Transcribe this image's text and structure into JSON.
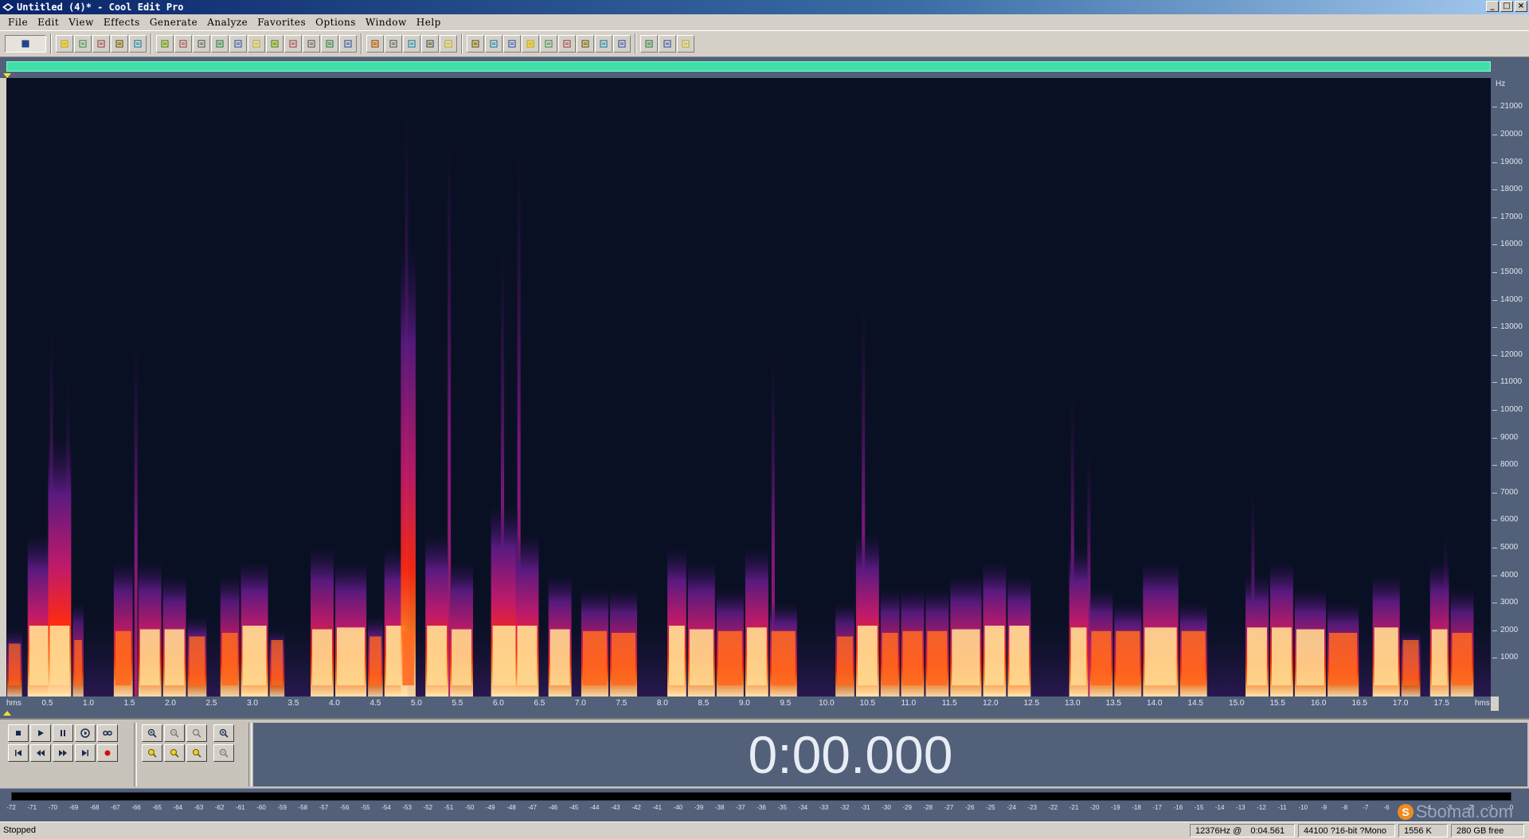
{
  "window": {
    "title": "Untitled (4)* - Cool Edit Pro",
    "controls": [
      "_",
      "□",
      "×"
    ]
  },
  "menu": [
    "File",
    "Edit",
    "View",
    "Effects",
    "Generate",
    "Analyze",
    "Favorites",
    "Options",
    "Window",
    "Help"
  ],
  "toolbar": {
    "groups": [
      [
        "waveform-view-toggle-icon"
      ],
      [
        "new-file-icon",
        "open-file-icon",
        "save-icon",
        "save-as-icon",
        "close-icon"
      ],
      [
        "undo-icon",
        "redo-icon",
        "repeat-icon",
        "copy-icon",
        "copy-to-new-icon",
        "cut-icon",
        "paste-icon",
        "paste-to-new-icon",
        "mix-paste-icon",
        "trim-icon",
        "crossfade-icon"
      ],
      [
        "spectral-view-icon",
        "waveform-icon",
        "grid-icon",
        "frames-icon",
        "snap-icon"
      ],
      [
        "cue-list-icon",
        "play-list-icon",
        "info-icon",
        "play-icon",
        "find-icon",
        "timecode-icon",
        "bar-icon",
        "level-meter-icon",
        "time-window-icon"
      ],
      [
        "options-icon",
        "script-icon",
        "help-icon"
      ]
    ]
  },
  "spectrum": {
    "y_unit": "Hz",
    "y_ticks": [
      "21000",
      "20000",
      "19000",
      "18000",
      "17000",
      "16000",
      "15000",
      "14000",
      "13000",
      "12000",
      "11000",
      "10000",
      "9000",
      "8000",
      "7000",
      "6000",
      "5000",
      "4000",
      "3000",
      "2000",
      "1000"
    ],
    "x_unit_left": "hms",
    "x_unit_right": "hms",
    "x_ticks": [
      "0.5",
      "1.0",
      "1.5",
      "2.0",
      "2.5",
      "3.0",
      "3.5",
      "4.0",
      "4.5",
      "5.0",
      "5.5",
      "6.0",
      "6.5",
      "7.0",
      "7.5",
      "8.0",
      "8.5",
      "9.0",
      "9.5",
      "10.0",
      "10.5",
      "11.0",
      "11.5",
      "12.0",
      "12.5",
      "13.0",
      "13.5",
      "14.0",
      "14.5",
      "15.0",
      "15.5",
      "16.0",
      "16.5",
      "17.0",
      "17.5"
    ],
    "duration_s": 18.1,
    "colors": {
      "background": "#0a1024",
      "low": "#3a1060",
      "mid": "#c01a6a",
      "high": "#ff3a10",
      "peak": "#ffe8b0"
    },
    "bursts": [
      [
        0.0,
        0.2,
        2.0,
        0.5
      ],
      [
        0.25,
        0.55,
        5.5,
        1.0
      ],
      [
        0.5,
        0.8,
        9.0,
        1.0
      ],
      [
        0.8,
        0.95,
        3.0,
        0.6
      ],
      [
        1.3,
        1.55,
        4.5,
        0.85
      ],
      [
        1.6,
        1.9,
        4.5,
        0.9
      ],
      [
        1.9,
        2.2,
        4.0,
        0.9
      ],
      [
        2.2,
        2.45,
        2.5,
        0.7
      ],
      [
        2.6,
        2.85,
        4.0,
        0.8
      ],
      [
        2.85,
        3.2,
        4.5,
        1.0
      ],
      [
        3.2,
        3.4,
        2.0,
        0.6
      ],
      [
        3.7,
        4.0,
        5.0,
        0.9
      ],
      [
        4.0,
        4.4,
        4.5,
        0.95
      ],
      [
        4.4,
        4.6,
        2.5,
        0.7
      ],
      [
        4.6,
        4.9,
        5.0,
        1.0
      ],
      [
        4.8,
        5.0,
        16.0,
        0.85
      ],
      [
        5.1,
        5.4,
        5.5,
        1.0
      ],
      [
        5.4,
        5.7,
        4.5,
        0.9
      ],
      [
        5.9,
        6.25,
        6.5,
        1.0
      ],
      [
        6.2,
        6.5,
        5.5,
        1.0
      ],
      [
        6.6,
        6.9,
        4.0,
        0.9
      ],
      [
        7.0,
        7.35,
        3.5,
        0.85
      ],
      [
        7.35,
        7.7,
        3.5,
        0.8
      ],
      [
        8.05,
        8.3,
        5.0,
        1.0
      ],
      [
        8.3,
        8.65,
        4.5,
        0.9
      ],
      [
        8.65,
        9.0,
        3.5,
        0.85
      ],
      [
        9.0,
        9.3,
        5.0,
        0.95
      ],
      [
        9.3,
        9.65,
        3.0,
        0.85
      ],
      [
        10.1,
        10.35,
        3.0,
        0.7
      ],
      [
        10.35,
        10.65,
        5.5,
        1.0
      ],
      [
        10.65,
        10.9,
        3.5,
        0.8
      ],
      [
        10.9,
        11.2,
        3.5,
        0.85
      ],
      [
        11.2,
        11.5,
        3.5,
        0.85
      ],
      [
        11.5,
        11.9,
        4.0,
        0.9
      ],
      [
        11.9,
        12.2,
        4.5,
        1.0
      ],
      [
        12.2,
        12.5,
        4.0,
        1.0
      ],
      [
        12.95,
        13.2,
        5.0,
        0.95
      ],
      [
        13.2,
        13.5,
        3.5,
        0.85
      ],
      [
        13.5,
        13.85,
        3.0,
        0.85
      ],
      [
        13.85,
        14.3,
        4.5,
        0.95
      ],
      [
        14.3,
        14.65,
        3.0,
        0.85
      ],
      [
        15.1,
        15.4,
        4.0,
        0.95
      ],
      [
        15.4,
        15.7,
        4.5,
        0.95
      ],
      [
        15.7,
        16.1,
        3.5,
        0.9
      ],
      [
        16.1,
        16.5,
        3.0,
        0.8
      ],
      [
        16.65,
        17.0,
        4.0,
        0.95
      ],
      [
        17.0,
        17.25,
        2.0,
        0.6
      ],
      [
        17.35,
        17.6,
        4.5,
        0.9
      ],
      [
        17.6,
        17.9,
        3.5,
        0.8
      ]
    ],
    "spikes": [
      [
        0.55,
        13.0
      ],
      [
        0.75,
        11.0
      ],
      [
        1.58,
        12.5
      ],
      [
        4.88,
        21.0
      ],
      [
        5.4,
        20.0
      ],
      [
        6.25,
        19.5
      ],
      [
        6.05,
        16.0
      ],
      [
        9.35,
        12.0
      ],
      [
        10.45,
        14.0
      ],
      [
        13.0,
        10.5
      ],
      [
        13.2,
        8.5
      ],
      [
        15.2,
        7.0
      ],
      [
        17.55,
        5.5
      ]
    ]
  },
  "transport": {
    "row1": [
      "stop-icon",
      "play-icon",
      "pause-icon",
      "play-to-end-icon",
      "loop-icon"
    ],
    "row2": [
      "go-to-start-icon",
      "rewind-icon",
      "fast-forward-icon",
      "go-to-end-icon",
      "record-icon"
    ]
  },
  "zoom": {
    "row1": [
      "zoom-in-horizontal-icon",
      "zoom-out-horizontal-icon",
      "zoom-full-icon",
      "zoom-in-vertical-icon"
    ],
    "row2": [
      "zoom-left-icon",
      "zoom-right-icon",
      "zoom-selection-icon",
      "zoom-out-vertical-icon"
    ]
  },
  "time_display": "0:00.000",
  "level_meter": {
    "ticks": [
      "-72",
      "-71",
      "-70",
      "-69",
      "-68",
      "-67",
      "-66",
      "-65",
      "-64",
      "-63",
      "-62",
      "-61",
      "-60",
      "-59",
      "-58",
      "-57",
      "-56",
      "-55",
      "-54",
      "-53",
      "-52",
      "-51",
      "-50",
      "-49",
      "-48",
      "-47",
      "-46",
      "-45",
      "-44",
      "-43",
      "-42",
      "-41",
      "-40",
      "-39",
      "-38",
      "-37",
      "-36",
      "-35",
      "-34",
      "-33",
      "-32",
      "-31",
      "-30",
      "-29",
      "-28",
      "-27",
      "-26",
      "-25",
      "-24",
      "-23",
      "-22",
      "-21",
      "-20",
      "-19",
      "-18",
      "-17",
      "-16",
      "-15",
      "-14",
      "-13",
      "-12",
      "-11",
      "-10",
      "-9",
      "-8",
      "-7",
      "-6",
      "-5",
      "-4",
      "-3",
      "-2",
      "-1",
      "0"
    ]
  },
  "watermark": "Soomal.com",
  "status": {
    "state": "Stopped",
    "cursor_freq": "12376Hz @",
    "cursor_time": "0:04.561",
    "format": "44100 ?16-bit ?Mono",
    "file_size": "1556 K",
    "disk_free": "280 GB free"
  }
}
